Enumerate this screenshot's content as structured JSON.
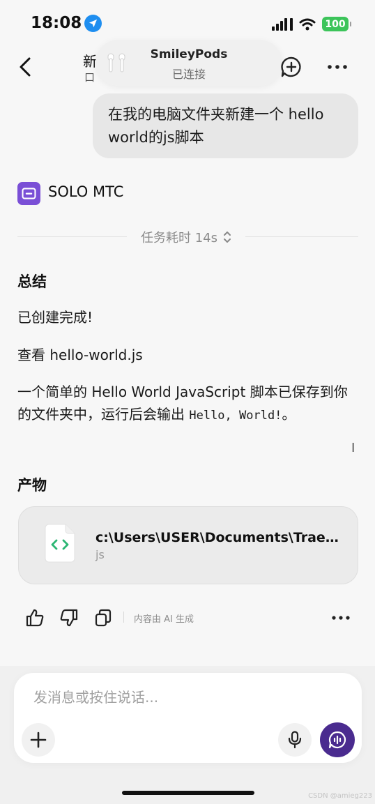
{
  "status_bar": {
    "time": "18:08",
    "battery": "100",
    "location_icon": "location-arrow-icon",
    "signal_icon": "cellular-signal-icon",
    "wifi_icon": "wifi-icon"
  },
  "header": {
    "title_peek": "新",
    "subtitle_peek": "口",
    "back_icon": "chevron-left-icon",
    "new_chat_icon": "new-chat-plus-icon",
    "more_icon": "more-horizontal-icon"
  },
  "airpods_popup": {
    "device_name": "SmileyPods",
    "status": "已连接",
    "icon": "airpods-icon"
  },
  "user_message": {
    "text": "在我的电脑文件夹新建一个 hello world的js脚本"
  },
  "agent": {
    "name": "SOLO MTC",
    "avatar_icon": "robot-icon",
    "avatar_color": "#7a4fd6"
  },
  "task": {
    "duration_label": "任务耗时 14s",
    "expand_icon": "chevron-up-down-icon"
  },
  "summary": {
    "heading": "总结",
    "created": "已创建完成!",
    "view_file": "查看 hello-world.js",
    "description_prefix": "一个简单的 Hello World JavaScript 脚本已保存到你的文件夹中，运行后会输出 ",
    "output_code": "Hello, World!",
    "description_suffix": "。"
  },
  "artifacts": {
    "heading": "产物",
    "items": [
      {
        "name": "c:\\Users\\USER\\Documents\\TraeSol...",
        "type": "js",
        "icon": "code-file-icon",
        "icon_color": "#2bb673"
      }
    ]
  },
  "feedback": {
    "like_icon": "thumbs-up-icon",
    "dislike_icon": "thumbs-down-icon",
    "copy_icon": "copy-icon",
    "ai_note": "内容由 AI 生成",
    "more_icon": "more-horizontal-icon"
  },
  "composer": {
    "placeholder": "发消息或按住说话...",
    "value": "",
    "plus_icon": "plus-icon",
    "mic_icon": "microphone-icon",
    "voice_icon": "voice-chat-icon",
    "accent": "#4a2b8f"
  },
  "watermark": "CSDN @amieg223"
}
